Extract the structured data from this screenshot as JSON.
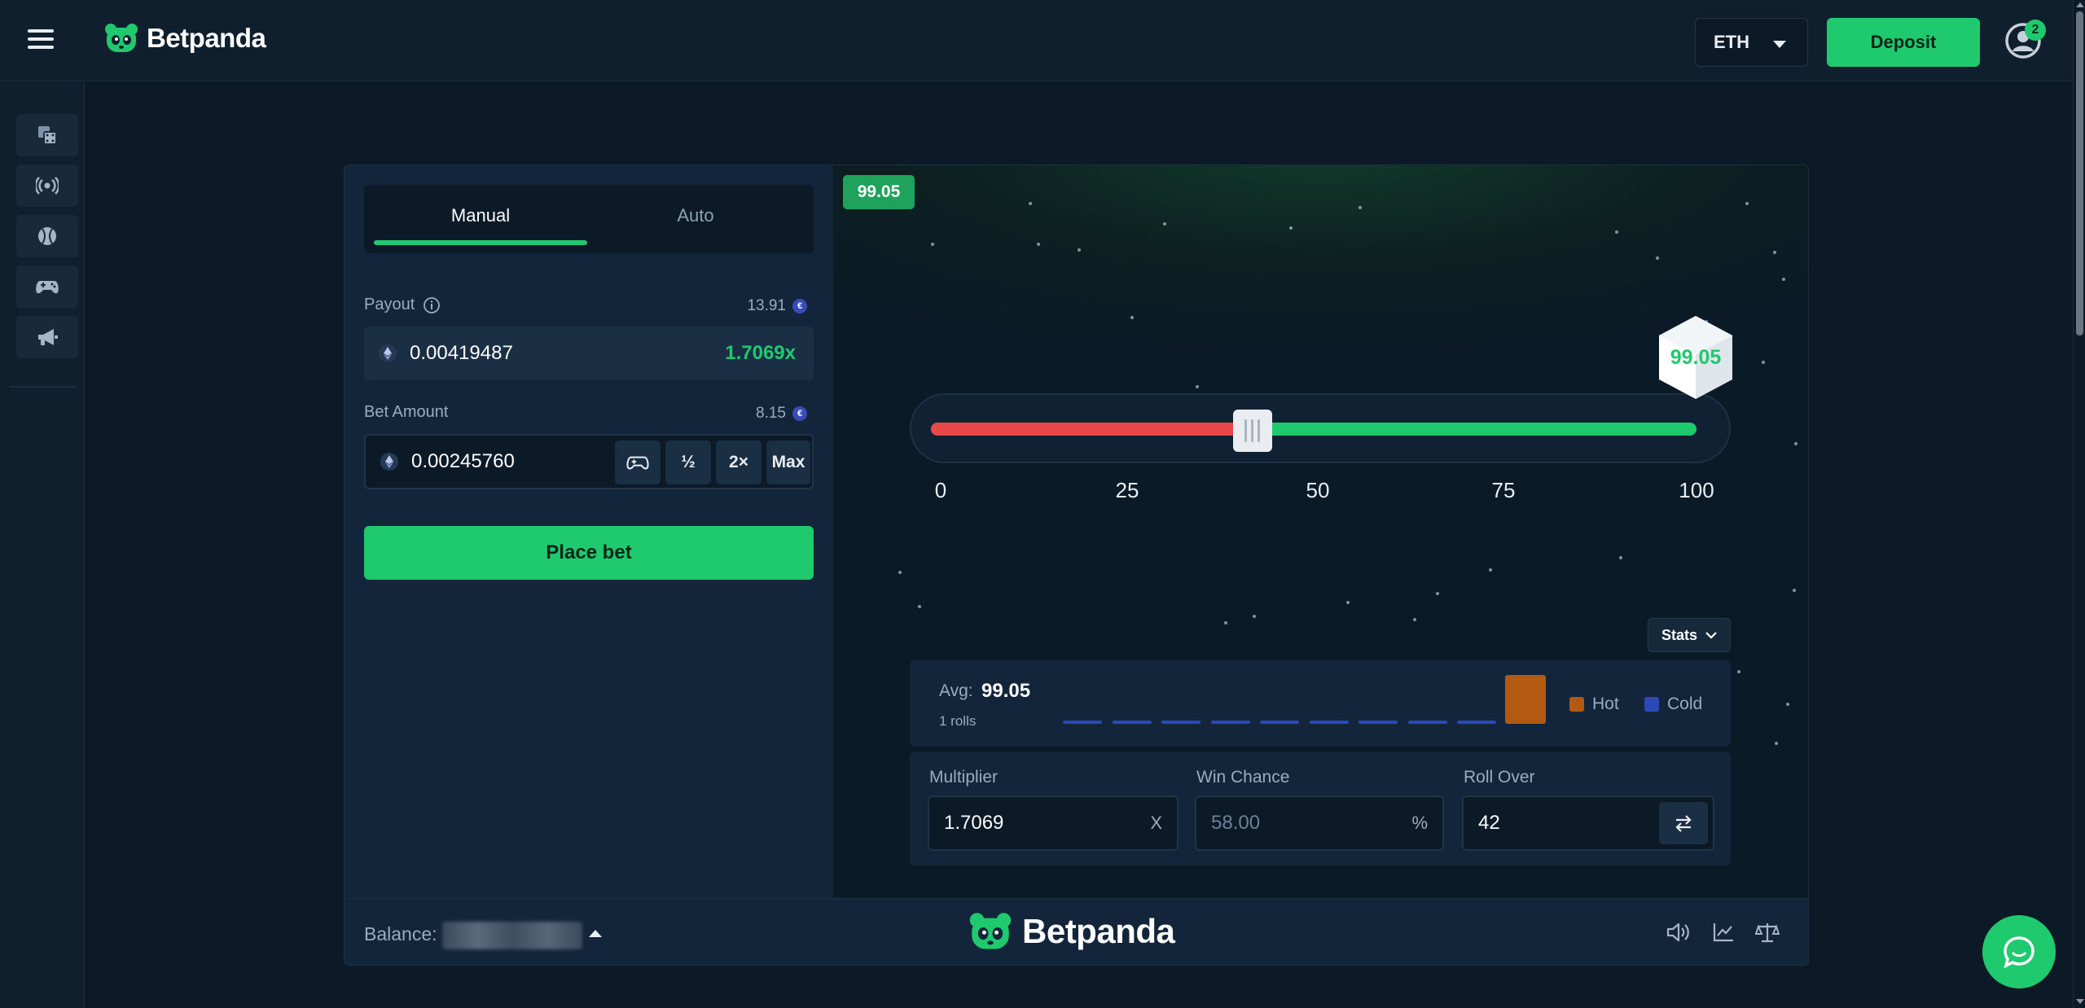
{
  "brand": {
    "name": "Betpanda"
  },
  "topbar": {
    "currency": "ETH",
    "deposit_label": "Deposit",
    "notification_count": "2"
  },
  "rail": {
    "items": [
      "casino-icon",
      "live-icon",
      "sports-icon",
      "games-icon",
      "promotions-icon"
    ]
  },
  "bet_panel": {
    "tabs": [
      {
        "label": "Manual",
        "active": true
      },
      {
        "label": "Auto",
        "active": false
      }
    ],
    "payout": {
      "label": "Payout",
      "side_value": "13.91",
      "amount": "0.00419487",
      "multiplier": "1.7069x"
    },
    "bet_amount": {
      "label": "Bet Amount",
      "side_value": "8.15",
      "amount": "0.00245760",
      "buttons": {
        "half": "½",
        "double": "2×",
        "max": "Max"
      }
    },
    "place_bet_label": "Place bet"
  },
  "game": {
    "last_result": "99.05",
    "dice_value": "99.05",
    "slider": {
      "min": 0,
      "max": 100,
      "roll_over": 42,
      "ticks": [
        "0",
        "25",
        "50",
        "75",
        "100"
      ]
    },
    "stats": {
      "button_label": "Stats",
      "avg_label": "Avg:",
      "avg_value": "99.05",
      "rolls_label": "1 rolls",
      "legend": {
        "hot": "Hot",
        "cold": "Cold"
      },
      "colors": {
        "hot": "#b35a12",
        "cold": "#2b4ab8"
      }
    },
    "controls": {
      "multiplier": {
        "label": "Multiplier",
        "value": "1.7069",
        "suffix": "X"
      },
      "win_chance": {
        "label": "Win Chance",
        "value": "58.00",
        "suffix": "%"
      },
      "roll_over": {
        "label": "Roll Over",
        "value": "42"
      }
    }
  },
  "footer": {
    "balance_label": "Balance:",
    "icons": [
      "sound-icon",
      "chart-icon",
      "fairness-icon"
    ]
  },
  "colors": {
    "accent": "#1fc96e",
    "lose": "#e84848",
    "background": "#0c1a27"
  }
}
